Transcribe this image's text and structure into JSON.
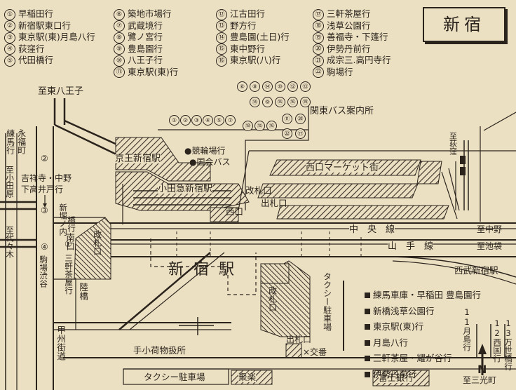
{
  "title": "新宿",
  "legend": [
    {
      "num": "①",
      "label": "早稲田行"
    },
    {
      "num": "②",
      "label": "新宿駅東口行"
    },
    {
      "num": "③",
      "label": "東京駅(東)月島八行"
    },
    {
      "num": "④",
      "label": "荻窪行"
    },
    {
      "num": "⑤",
      "label": "代田橋行"
    },
    {
      "num": "⑥",
      "label": "築地市場行"
    },
    {
      "num": "⑦",
      "label": "武蔵境行"
    },
    {
      "num": "⑧",
      "label": "鷺ノ宮行"
    },
    {
      "num": "⑨",
      "label": "豊島園行"
    },
    {
      "num": "⑩",
      "label": "八王子行"
    },
    {
      "num": "⑪",
      "label": "東京駅(東)行"
    },
    {
      "num": "⑫",
      "label": "江古田行"
    },
    {
      "num": "⑬",
      "label": "野方行"
    },
    {
      "num": "⑭",
      "label": "豊島園(土日)行"
    },
    {
      "num": "⑮",
      "label": "東中野行"
    },
    {
      "num": "⑯",
      "label": "東京駅(八)行"
    },
    {
      "num": "⑰",
      "label": "三軒茶屋行"
    },
    {
      "num": "⑱",
      "label": "浅草公園行"
    },
    {
      "num": "⑲",
      "label": "善福寺・下篷行"
    },
    {
      "num": "⑳",
      "label": "伊勢丹前行"
    },
    {
      "num": "㉑",
      "label": "成宗三.高円寺行"
    },
    {
      "num": "㉒",
      "label": "駒場行"
    }
  ],
  "bus_stops": {
    "row1": [
      "⑥",
      "⑧",
      "⑭",
      "⑩",
      "⑫",
      "⑬"
    ],
    "row2": [
      "⑭",
      "⑨",
      "⑮",
      "⑯",
      "⑲"
    ],
    "row3": [
      "①",
      "②",
      "③",
      "④",
      "⑤",
      "⑦",
      "⑱",
      "⑮",
      "⑯",
      "⑪",
      "⑳"
    ],
    "row4": [
      "㉒",
      "⑰"
    ]
  },
  "labels": {
    "kanto_bus": "関東バス案内所",
    "to_hachioji": "至東八王子",
    "keio": "京王新宿駅",
    "keirinjo": "●競輪場行",
    "kokkai": "●国会バス",
    "nishiguchi_market": "西口マーケット街",
    "odakyu": "小田急新宿駅",
    "kaisatsu": "改札口",
    "shussatsu": "出札口",
    "nishiguchi": "西口",
    "chuo": "中　央　線",
    "yamanote": "山　手　線",
    "to_nakano": "至中野",
    "to_ikebukuro": "至池袋",
    "to_ogikubo": "至荻窪",
    "seibu": "西武新宿駅",
    "station": "新宿駅",
    "minamiguchi": "南口",
    "kaisatsu_s": "改札口",
    "rikkyo": "陸橋",
    "kaisatsu_e": "改札口",
    "taxi_v": "タクシー駐車場",
    "tenimotsu": "手小荷物扱所",
    "shussatsu_e": "出札口",
    "koban": "×交番",
    "taxi_h": "タクシー駐車場",
    "juraku": "聚楽",
    "fuji_bank": "富士銀行",
    "to_sankocho": "至三光町",
    "koshu": "甲州街道",
    "eifukucho": "永福町",
    "nerima": "練馬行",
    "kichijoji": "吉祥寺・中野",
    "shimotakaido": "下高井戸行",
    "to_odawara": "至小田原",
    "to_yoyogi": "至代々木",
    "shinbashi_horinouchi": "新堀ノ内",
    "hashi": "橋行",
    "komaba_shibuya": "駒場渋谷",
    "sangenjaya": "三軒茶屋行",
    "num1": "①",
    "num2": "②",
    "num3": "③",
    "num4": "④",
    "tsukishima": "11月島行",
    "nishi_kokubunji": "12西国行",
    "mansei": "13万世橋行"
  },
  "east_destinations": [
    "練馬車庫・早稲田 豊島園行",
    "新橋浅草公園行",
    "東京駅(東)行",
    "月島八行",
    "三軒茶屋・耀が谷行",
    "伊勢丹前行"
  ]
}
